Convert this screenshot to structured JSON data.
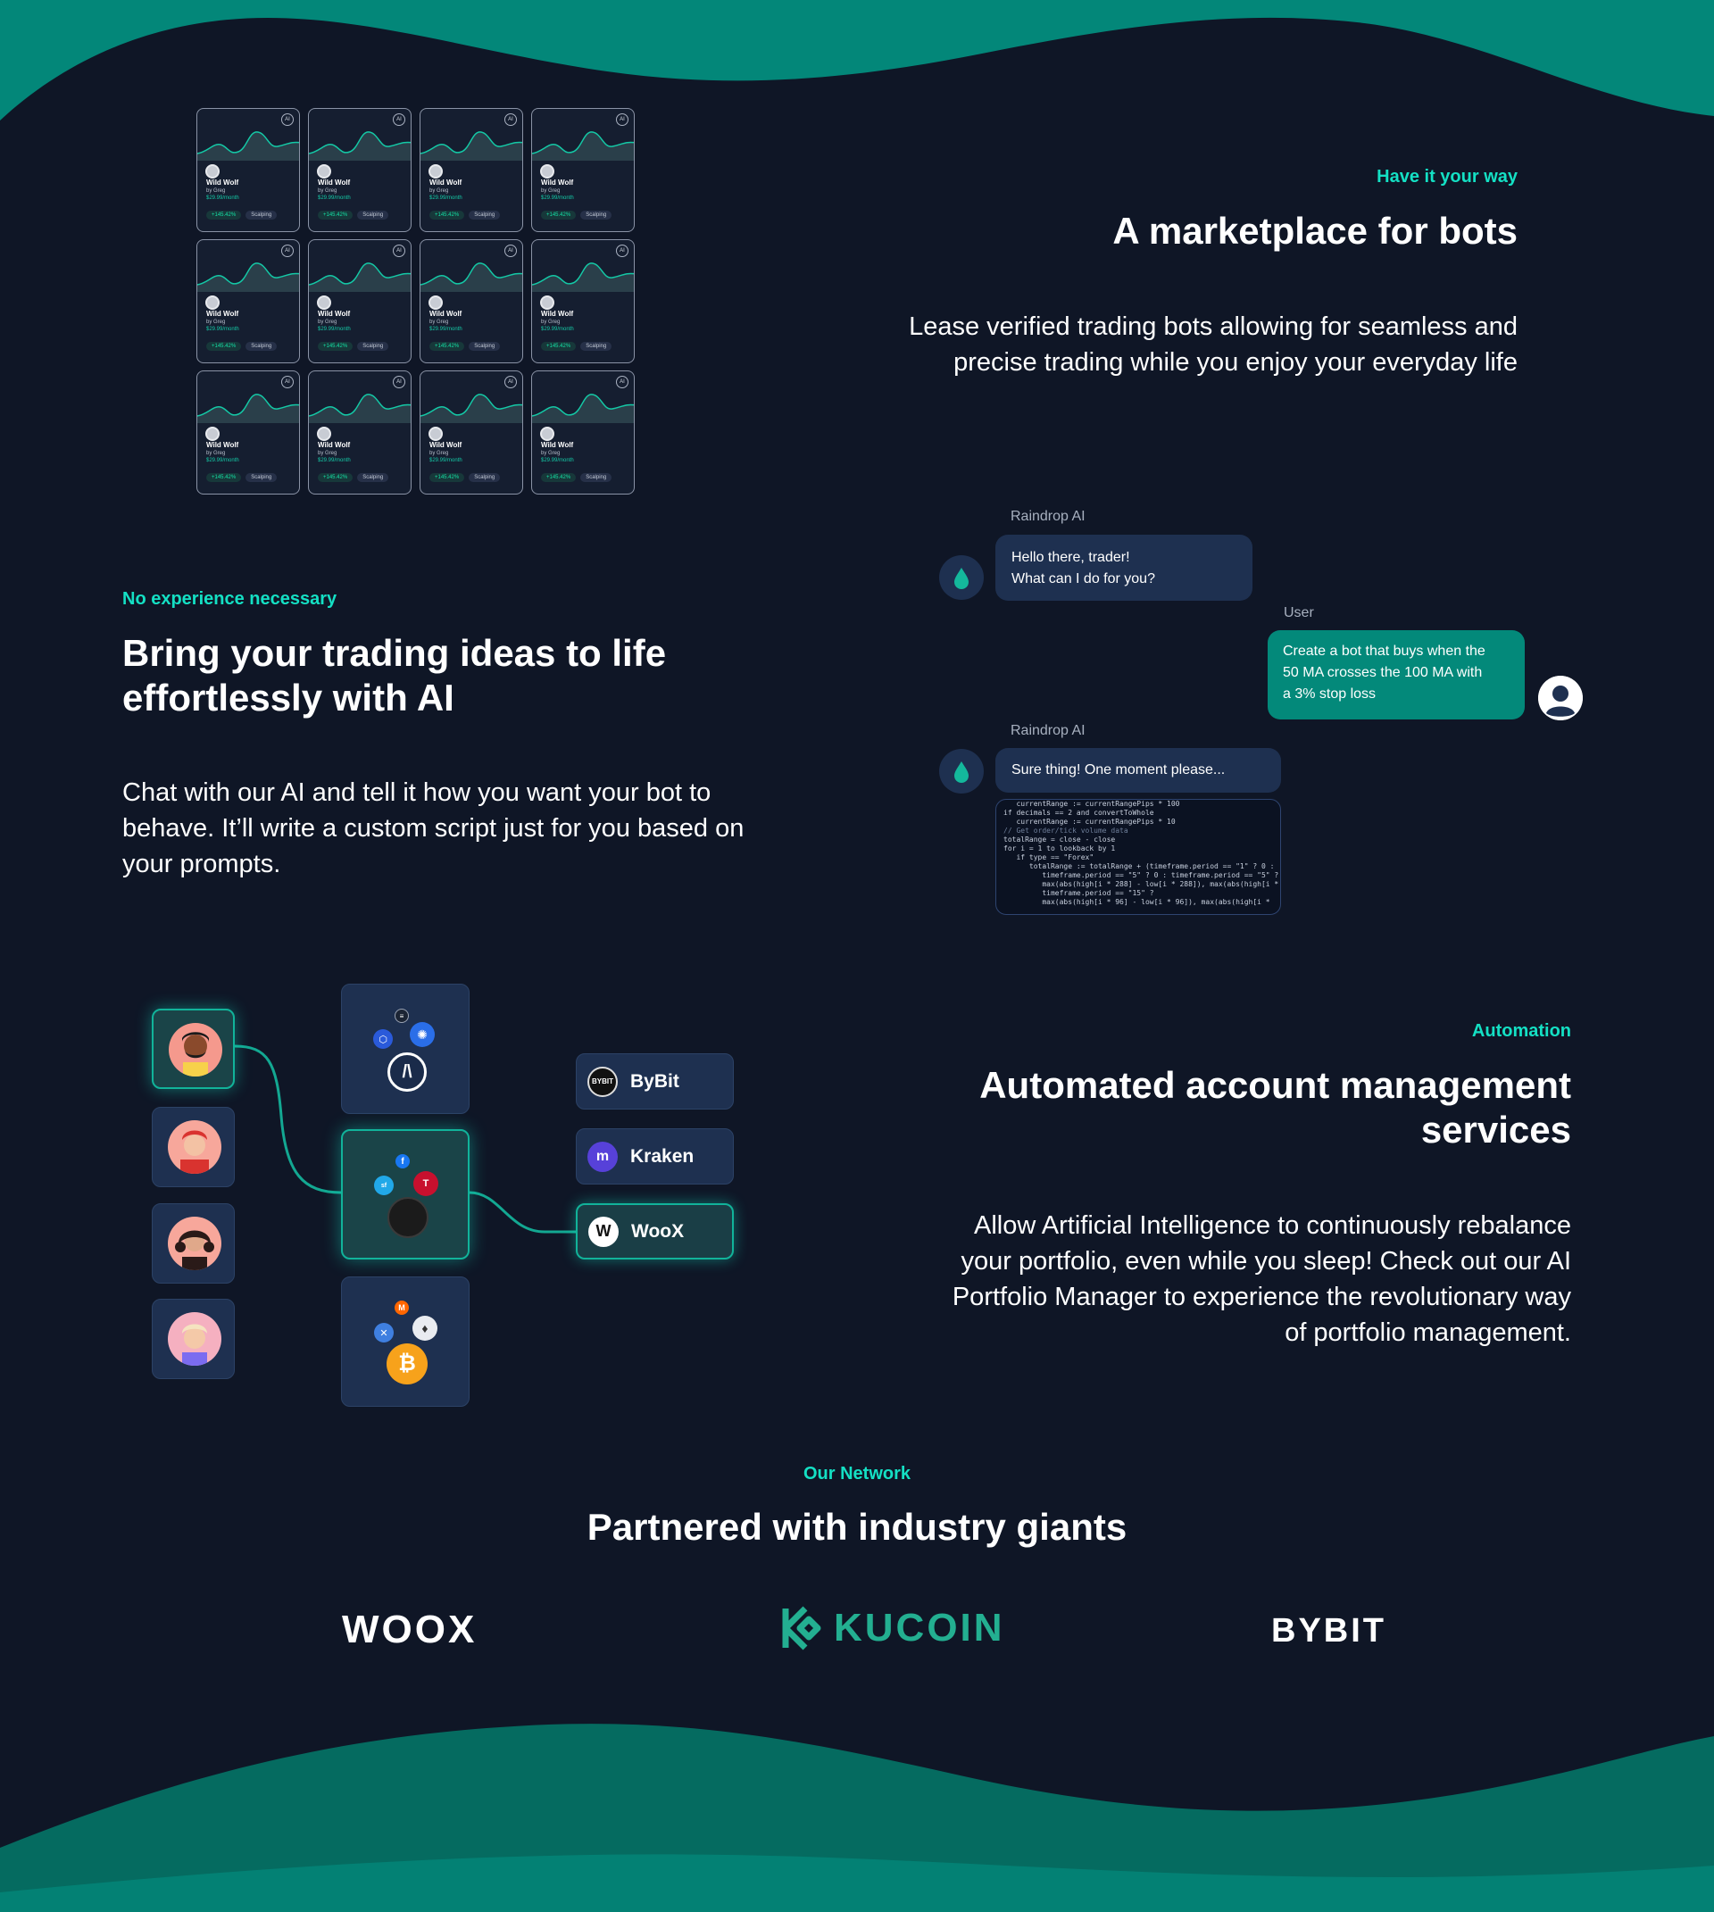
{
  "colors": {
    "background": "#0f1626",
    "accent": "#14e0c4",
    "wave": "#038779",
    "bubble_ai": "#1e3050",
    "bubble_user": "#03897a"
  },
  "marketplace": {
    "eyebrow": "Have it your way",
    "title": "A marketplace for bots",
    "body_line1": "Lease verified trading bots allowing for seamless and",
    "body_line2": "precise trading while you enjoy your everyday life",
    "bot_card": {
      "name": "Wild Wolf",
      "author": "by Greg",
      "price": "$29.99/month",
      "gain_tag": "+145.42%",
      "style_tag": "Scalping",
      "corner_badge": "AI"
    }
  },
  "ai_section": {
    "eyebrow": "No experience necessary",
    "title_line1": "Bring your trading ideas to life",
    "title_line2": "effortlessly with AI",
    "body_line1": "Chat with our AI and tell it how you want your bot to",
    "body_line2": "behave. It’ll write a custom script just for you based on",
    "body_line3": "your prompts."
  },
  "chat": {
    "ai_name": "Raindrop AI",
    "user_name": "User",
    "msg1_line1": "Hello there, trader!",
    "msg1_line2": "What can I do for you?",
    "msg2_line1": "Create a bot that buys when the",
    "msg2_line2": "50 MA crosses the 100 MA with",
    "msg2_line3": "a 3% stop loss",
    "msg3": "Sure thing! One moment please...",
    "code": [
      "   currentRange := currentRangePips * 100",
      "if decimals == 2 and convertToWhole",
      "   currentRange := currentRangePips * 10",
      "",
      "// Get order/tick volume data",
      "totalRange = close - close",
      "for i = 1 to lookback by 1",
      "   if type == \"Forex\"",
      "      totalRange := totalRange + (timeframe.period == \"1\" ? 0 :",
      "         timeframe.period == \"5\" ? 0 : timeframe.period == \"5\" ?",
      "         max(abs(high[i * 288] - low[i * 288]), max(abs(high[i *",
      "         timeframe.period == \"15\" ?",
      "         max(abs(high[i * 96] - low[i * 96]), max(abs(high[i *"
    ]
  },
  "automation": {
    "eyebrow": "Automation",
    "title_line1": "Automated account management",
    "title_line2": "services",
    "body_line1": "Allow Artificial Intelligence to continuously rebalance",
    "body_line2": "your portfolio, even while you sleep! Check out our AI",
    "body_line3": "Portfolio Manager to experience the revolutionary way",
    "body_line4": "of portfolio management.",
    "exchanges": [
      "ByBit",
      "Kraken",
      "WooX"
    ]
  },
  "network": {
    "eyebrow": "Our Network",
    "title": "Partnered with industry giants",
    "partners": [
      "WOOX",
      "KUCOIN",
      "BYBIT"
    ]
  }
}
